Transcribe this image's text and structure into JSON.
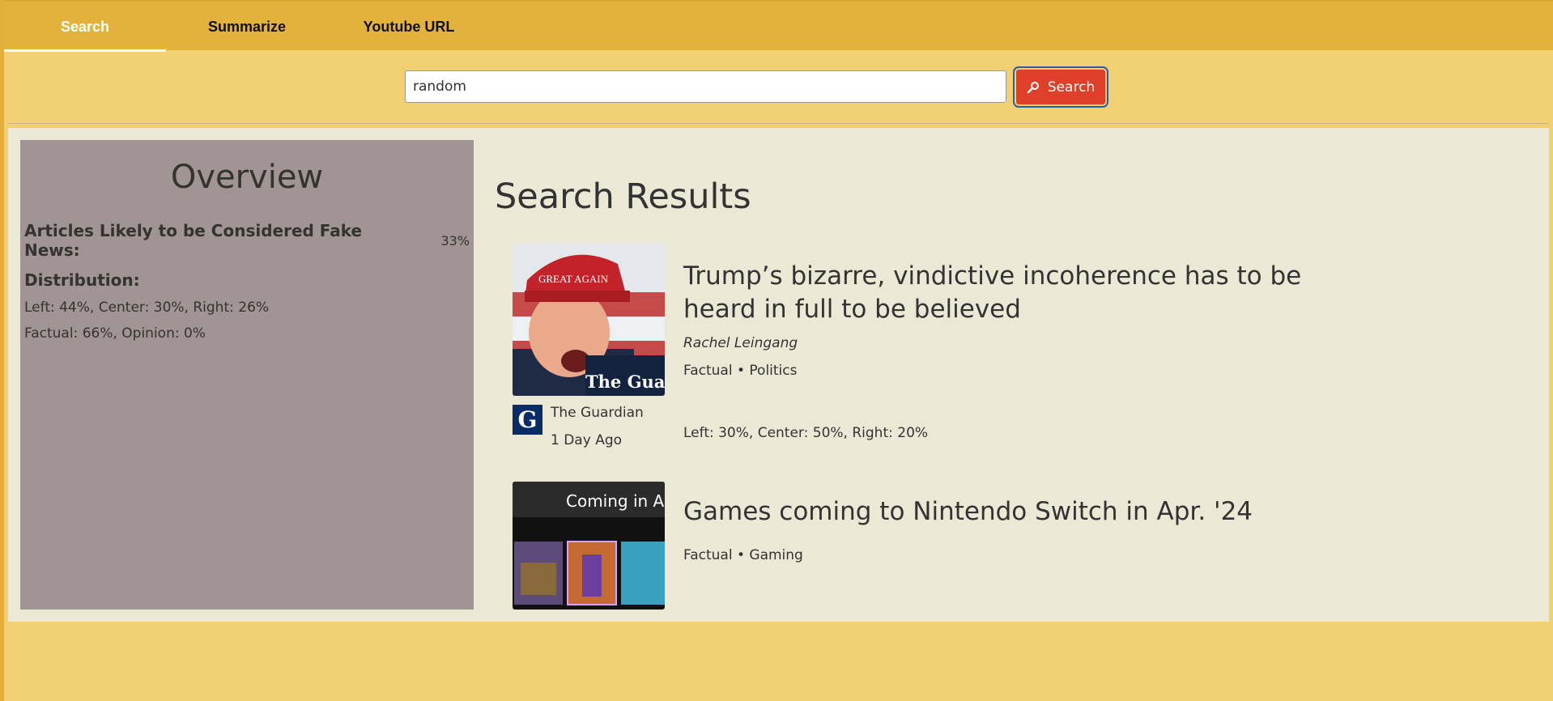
{
  "tabs": [
    {
      "label": "Search",
      "active": true
    },
    {
      "label": "Summarize",
      "active": false
    },
    {
      "label": "Youtube URL",
      "active": false
    }
  ],
  "search": {
    "value": "random",
    "button_label": "Search",
    "button_icon": "search-icon"
  },
  "overview": {
    "title": "Overview",
    "fake_news_label": "Articles Likely to be Considered Fake News:",
    "fake_news_value": "33%",
    "distribution_label": "Distribution:",
    "lean_line": "Left: 44%, Center: 30%, Right: 26%",
    "type_line": "Factual: 66%, Opinion: 0%"
  },
  "results": {
    "title": "Search Results",
    "items": [
      {
        "title": "Trump’s bizarre, vindictive incoherence has to be heard in full to be believed",
        "author": "Rachel Leingang",
        "tags": "Factual • Politics",
        "source": "The Guardian",
        "age": "1 Day Ago",
        "lean": "Left: 30%, Center: 50%, Right: 20%",
        "image_caption": "The Guardian",
        "hat_text": "GREAT AGAIN",
        "logo_letter": "G"
      },
      {
        "title": "Games coming to Nintendo Switch in Apr. '24",
        "tags": "Factual • Gaming",
        "image_caption": "Coming in A"
      }
    ]
  },
  "colors": {
    "page_bg": "#f3cf74",
    "topbar": "#e3b23c",
    "search_button": "#e0402a",
    "content_bg": "#ece8d6",
    "overview_bg": "#a09494"
  }
}
